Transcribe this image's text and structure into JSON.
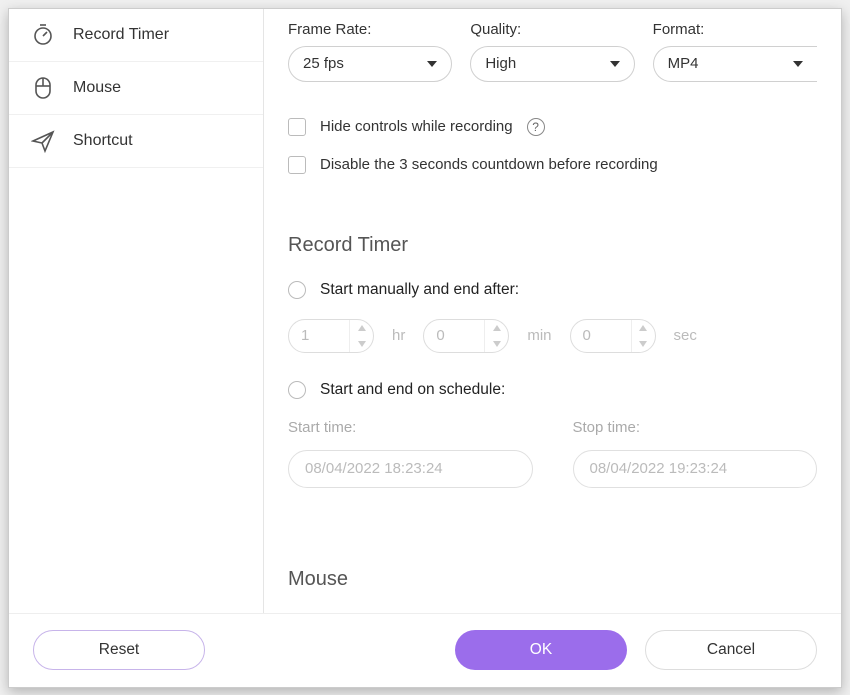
{
  "sidebar": {
    "items": [
      {
        "label": "Record Timer"
      },
      {
        "label": "Mouse"
      },
      {
        "label": "Shortcut"
      }
    ]
  },
  "settings": {
    "frame_rate": {
      "label": "Frame Rate:",
      "value": "25 fps"
    },
    "quality": {
      "label": "Quality:",
      "value": "High"
    },
    "format": {
      "label": "Format:",
      "value": "MP4"
    },
    "hide_controls": "Hide controls while recording",
    "disable_countdown": "Disable the 3 seconds countdown before recording"
  },
  "record_timer": {
    "title": "Record Timer",
    "option1": "Start manually and end after:",
    "option2": "Start and end on schedule:",
    "hr_value": "1",
    "hr_label": "hr",
    "min_value": "0",
    "min_label": "min",
    "sec_value": "0",
    "sec_label": "sec",
    "start_time_label": "Start time:",
    "stop_time_label": "Stop time:",
    "start_time": "08/04/2022 18:23:24",
    "stop_time": "08/04/2022 19:23:24"
  },
  "mouse": {
    "title": "Mouse"
  },
  "footer": {
    "reset": "Reset",
    "ok": "OK",
    "cancel": "Cancel"
  },
  "help_char": "?"
}
